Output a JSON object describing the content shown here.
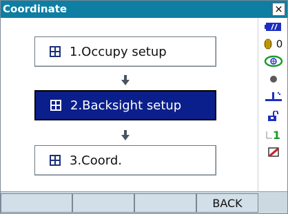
{
  "window": {
    "title": "Coordinate",
    "close_symbol": "×"
  },
  "menu": {
    "items": [
      {
        "label": "1.Occupy setup",
        "icon": "grid-icon",
        "selected": false
      },
      {
        "label": "2.Backsight setup",
        "icon": "grid-icon",
        "selected": true
      },
      {
        "label": "3.Coord.",
        "icon": "grid-icon",
        "selected": false
      }
    ],
    "arrow_icon": "arrow-down-icon"
  },
  "status_bar": {
    "battery_icon": "battery-icon",
    "prism_constant_icon": "prism-icon",
    "prism_constant_value": "0",
    "tilt_icon": "tilt-compensation-icon",
    "laser_icon": "laser-dot-icon",
    "level_icon": "level-icon",
    "lock_icon": "unlock-icon",
    "input_mode_text": "1",
    "memory_icon": "memory-card-icon"
  },
  "softkeys": {
    "labels": [
      "",
      "",
      "",
      "BACK"
    ]
  },
  "colors": {
    "title_bar": "#0e7ea3",
    "selected_item": "#0b1f8c",
    "softkey_bar": "#ccd9e1"
  }
}
